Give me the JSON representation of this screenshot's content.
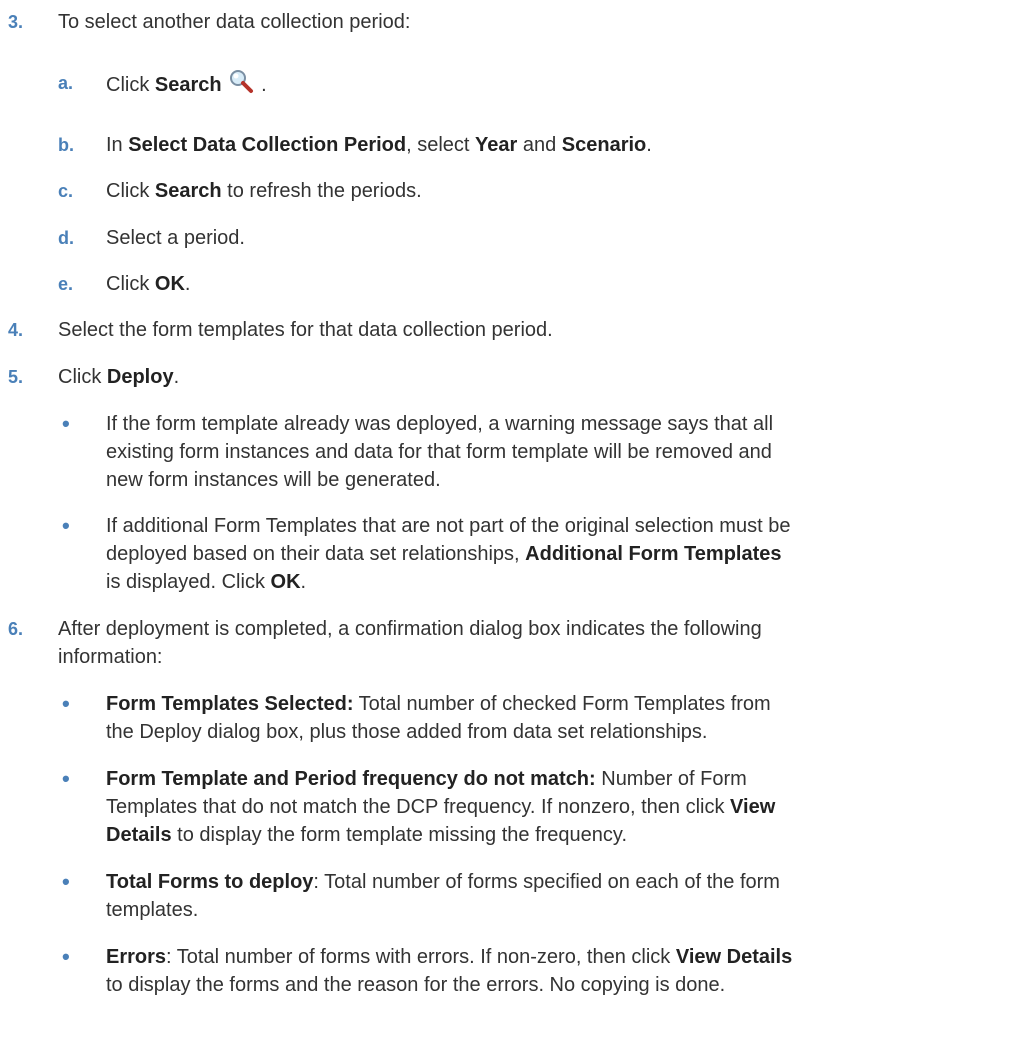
{
  "step3": {
    "num": "3.",
    "text": "To select another data collection period:",
    "subs": [
      {
        "letter": "a.",
        "pre": "Click ",
        "b1": "Search",
        "post": " ."
      },
      {
        "letter": "b.",
        "pre": "In ",
        "b1": "Select Data Collection Period",
        "mid1": ", select ",
        "b2": "Year",
        "mid2": " and ",
        "b3": "Scenario",
        "post": "."
      },
      {
        "letter": "c.",
        "pre": "Click ",
        "b1": "Search",
        "post": " to refresh the periods."
      },
      {
        "letter": "d.",
        "pre": "Select a period."
      },
      {
        "letter": "e.",
        "pre": "Click ",
        "b1": "OK",
        "post": "."
      }
    ]
  },
  "step4": {
    "num": "4.",
    "text": "Select the form templates for that data collection period."
  },
  "step5": {
    "num": "5.",
    "pre": "Click ",
    "b1": "Deploy",
    "post": ".",
    "bullets": [
      {
        "line1": "If the form template already was deployed, a warning message says that all",
        "line2": "existing form instances and data for that form template will be removed and",
        "line3": "new form instances will be generated."
      },
      {
        "line1": "If additional Form Templates that are not part of the original selection must be",
        "line2_pre": "deployed based on their data set relationships, ",
        "line2_b": "Additional Form Templates",
        "line3_pre": "is displayed. Click ",
        "line3_b": "OK",
        "line3_post": "."
      }
    ]
  },
  "step6": {
    "num": "6.",
    "line1": "After deployment is completed, a confirmation dialog box indicates the following",
    "line2": "information:",
    "bullets": [
      {
        "b1": "Form Templates Selected:",
        "line1_post": " Total number of checked Form Templates from",
        "line2": "the Deploy dialog box, plus those added from data set relationships."
      },
      {
        "b1": "Form Template and Period frequency do not match:",
        "line1_post": " Number of Form",
        "line2_pre": "Templates that do not match the DCP frequency. If nonzero, then click ",
        "line2_b": "View",
        "line3_b": "Details",
        "line3_post": " to display the form template missing the frequency."
      },
      {
        "b1": "Total Forms to deploy",
        "line1_post": ": Total number of forms specified on each of the form",
        "line2": "templates."
      },
      {
        "b1": "Errors",
        "line1_post": ": Total number of forms with errors. If non-zero, then click ",
        "line1_b2": "View Details",
        "line2": "to display the forms and the reason for the errors. No copying is done."
      }
    ]
  },
  "icons": {
    "search": "magnifier-icon"
  },
  "colors": {
    "numbering": "#4a80b8",
    "text": "#333333"
  }
}
